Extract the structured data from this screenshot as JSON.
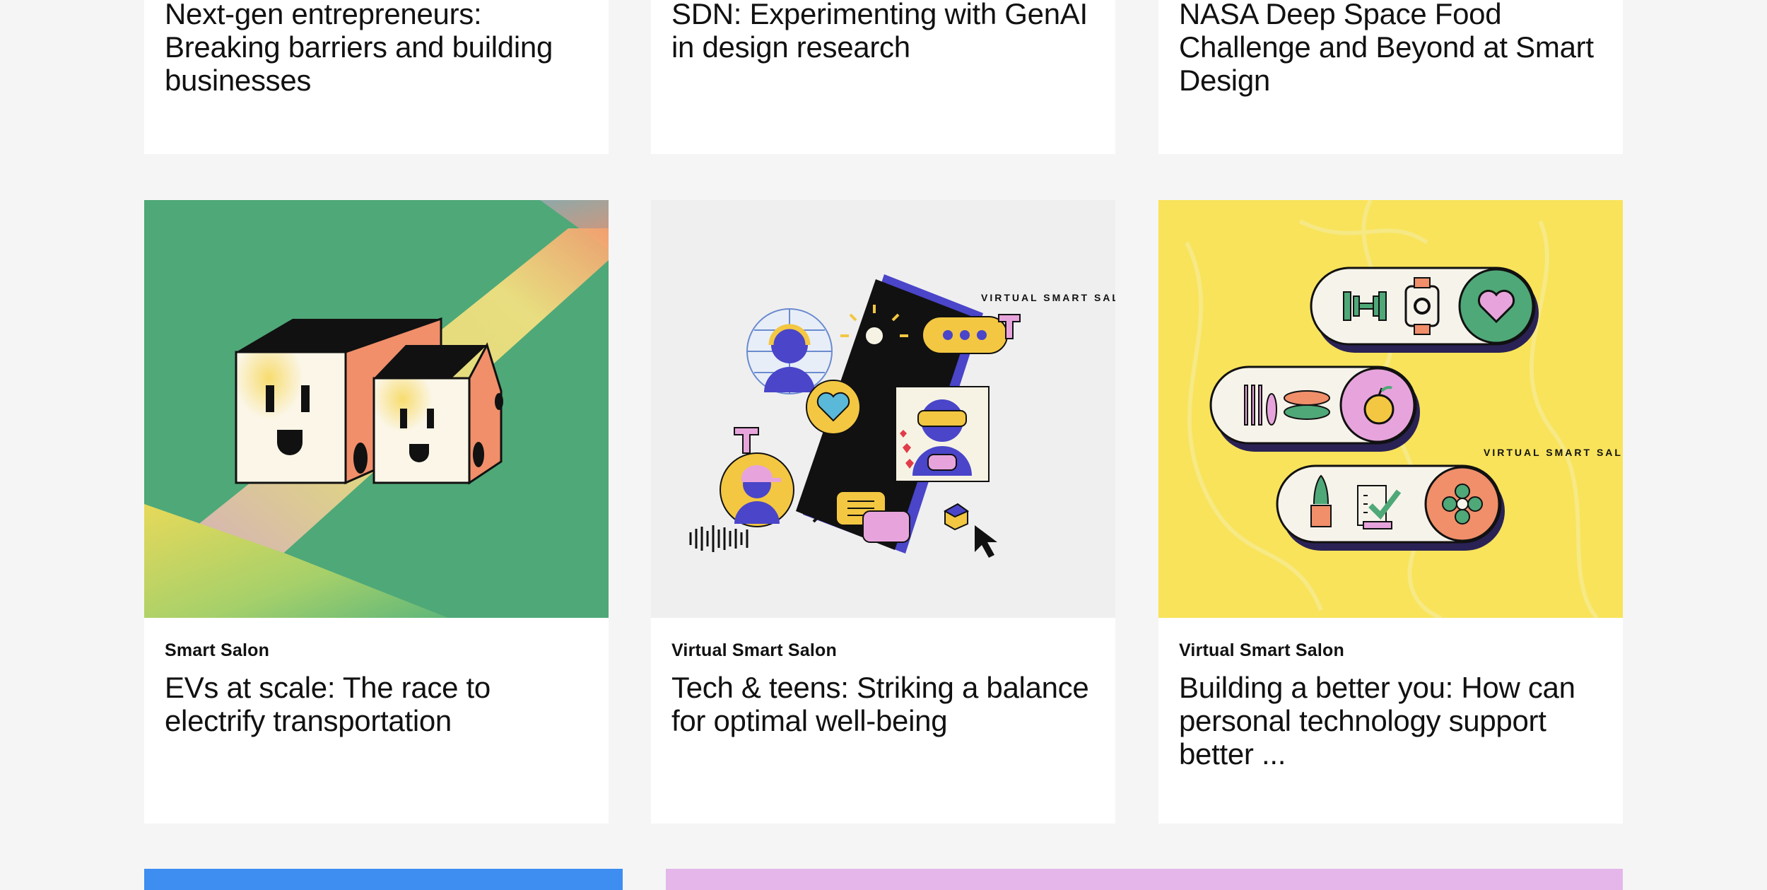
{
  "top_row": [
    {
      "title": "Next-gen entrepreneurs: Breaking barriers and building businesses"
    },
    {
      "title": "SDN: Experimenting with GenAI in design research"
    },
    {
      "title": "NASA Deep Space Food Challenge and Beyond at Smart Design"
    }
  ],
  "cards": [
    {
      "category": "Smart Salon",
      "title": "EVs at scale: The race to electrify transportation",
      "image_icon": "electric-trucks-illustration"
    },
    {
      "category": "Virtual Smart Salon",
      "title": "Tech & teens: Striking a balance for optimal well-being",
      "image_icon": "phone-teens-illustration",
      "badge": "VIRTUAL SMART SALON"
    },
    {
      "category": "Virtual Smart Salon",
      "title": "Building a better you: How can personal technology support better ...",
      "image_icon": "wellness-toggles-illustration",
      "badge": "VIRTUAL SMART SALON"
    }
  ],
  "colors": {
    "page_bg": "#f5f5f5",
    "card_bg": "#ffffff",
    "green": "#4fa878",
    "gray": "#efefef",
    "yellow": "#f8e35a",
    "bottom_blue": "#3d8ef0",
    "bottom_pink": "#e4b6ea"
  }
}
